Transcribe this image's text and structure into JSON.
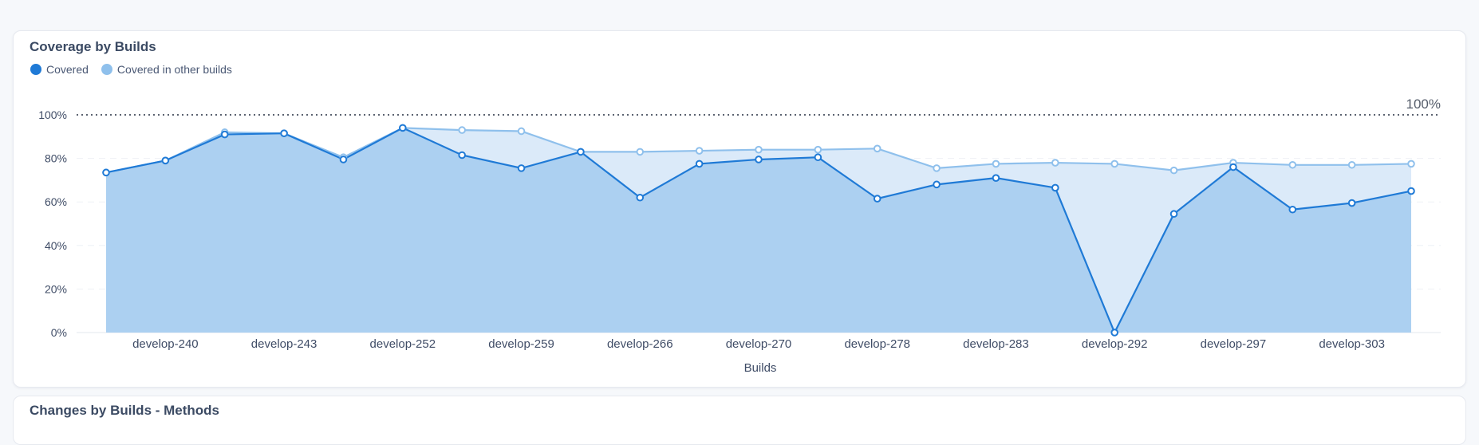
{
  "chart_card": {
    "title": "Coverage by Builds",
    "legend": [
      {
        "label": "Covered",
        "color": "#1f7ad6"
      },
      {
        "label": "Covered in other builds",
        "color": "#8fc0ec"
      }
    ]
  },
  "next_card": {
    "title": "Changes by Builds - Methods"
  },
  "chart_data": {
    "type": "area",
    "xlabel": "Builds",
    "ylabel": "",
    "ylim": [
      0,
      100
    ],
    "y_ticks": [
      "0%",
      "20%",
      "40%",
      "60%",
      "80%",
      "100%"
    ],
    "y_tick_values": [
      0,
      20,
      40,
      60,
      80,
      100
    ],
    "x_tick_labels": [
      "develop-240",
      "develop-243",
      "develop-252",
      "develop-259",
      "develop-266",
      "develop-270",
      "develop-278",
      "develop-283",
      "develop-292",
      "develop-297",
      "develop-303"
    ],
    "x_tick_indices": [
      1,
      3,
      5,
      7,
      9,
      11,
      13,
      15,
      17,
      19,
      21
    ],
    "reference_line": {
      "value": 100,
      "label": "100%",
      "style": "dotted"
    },
    "grid": true,
    "legend_position": "top-left",
    "series": [
      {
        "name": "Covered",
        "color": "#1f7ad6",
        "fill": "#acd0f1",
        "values": [
          73.5,
          79,
          91,
          91.5,
          79.5,
          94,
          81.5,
          75.5,
          83,
          62,
          77.5,
          79.5,
          80.5,
          61.5,
          68,
          71,
          66.5,
          0,
          54.5,
          76,
          56.5,
          59.5,
          65
        ]
      },
      {
        "name": "Covered in other builds",
        "color": "#8fc0ec",
        "fill": "#dbeaf9",
        "values": [
          73.5,
          79,
          92,
          91.5,
          80.5,
          94,
          93,
          92.5,
          83,
          83,
          83.5,
          84,
          84,
          84.5,
          75.5,
          77.5,
          78,
          77.5,
          74.5,
          78,
          77,
          77,
          77.5
        ]
      }
    ]
  }
}
